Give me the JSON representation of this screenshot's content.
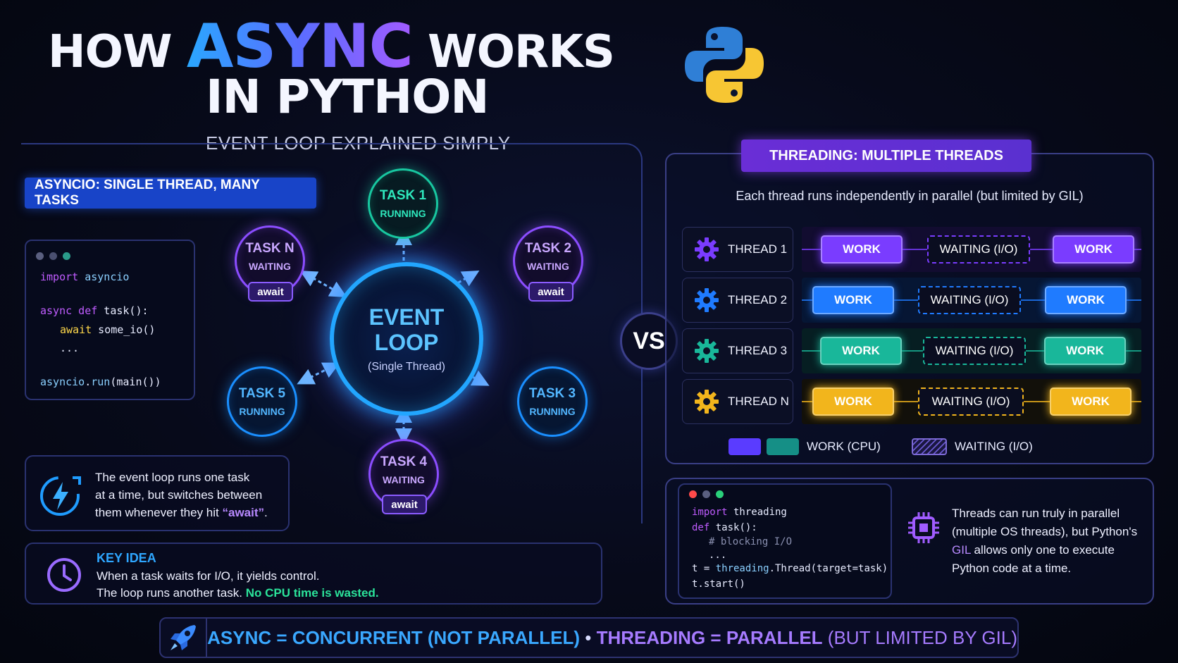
{
  "title": {
    "word1": "HOW",
    "word2": "ASYNC",
    "word3": "WORKS",
    "line2": "IN PYTHON",
    "subtitle": "EVENT LOOP EXPLAINED SIMPLY"
  },
  "asyncio": {
    "badge": "ASYNCIO: SINGLE THREAD, MANY TASKS",
    "code": {
      "l1_kw": "import",
      "l1_rest": " asyncio",
      "l2_kw": "async def",
      "l2_rest": " task():",
      "l3_kw": "await",
      "l3_rest": " some_io()",
      "l4": "...",
      "l5_a": "asyncio",
      "l5_b": ".",
      "l5_c": "run",
      "l5_d": "(main())"
    },
    "event_loop": {
      "line1": "EVENT",
      "line2": "LOOP",
      "sub": "(Single Thread)"
    },
    "tasks": [
      {
        "name": "TASK 1",
        "state": "RUNNING"
      },
      {
        "name": "TASK 2",
        "state": "WAITING",
        "pill": "await"
      },
      {
        "name": "TASK 3",
        "state": "RUNNING"
      },
      {
        "name": "TASK 4",
        "state": "WAITING",
        "pill": "await"
      },
      {
        "name": "TASK 5",
        "state": "RUNNING"
      },
      {
        "name": "TASK N",
        "state": "WAITING",
        "pill": "await"
      }
    ],
    "note": {
      "l1": "The event loop runs one task",
      "l2": "at a time, but switches between",
      "l3a": "them whenever they hit ",
      "l3b": "“await”",
      "l3c": "."
    },
    "key_idea": {
      "title": "KEY IDEA",
      "l1": "When a task waits for I/O, it yields control.",
      "l2a": "The loop runs another task. ",
      "l2b": "No CPU time is wasted."
    }
  },
  "vs": "VS",
  "threading": {
    "badge": "THREADING: MULTIPLE THREADS",
    "caption": "Each thread runs independently in parallel (but limited by GIL)",
    "threads": [
      {
        "name": "THREAD 1",
        "color": "#7a3cff",
        "work1": "WORK",
        "wait": "WAITING (I/O)",
        "work2": "WORK"
      },
      {
        "name": "THREAD 2",
        "color": "#1f7bff",
        "work1": "WORK",
        "wait": "WAITING (I/O)",
        "work2": "WORK"
      },
      {
        "name": "THREAD 3",
        "color": "#19b79a",
        "work1": "WORK",
        "wait": "WAITING (I/O)",
        "work2": "WORK"
      },
      {
        "name": "THREAD N",
        "color": "#f2b51c",
        "work1": "WORK",
        "wait": "WAITING (I/O)",
        "work2": "WORK"
      }
    ],
    "legend": {
      "work": "WORK (CPU)",
      "wait": "WAITING (I/O)"
    },
    "code": {
      "l1_kw": "import",
      "l1_rest": " threading",
      "l2_kw": "def",
      "l2_rest": " task():",
      "l3": "# blocking I/O",
      "l4": "...",
      "l5_a": "t = ",
      "l5_b": "threading",
      "l5_c": ".Thread(target=task)",
      "l6": "t.start()"
    },
    "note": {
      "l1": "Threads can run truly in parallel",
      "l2": "(multiple OS threads), but Python's",
      "l3a": "GIL",
      "l3b": " allows only one to execute",
      "l4": "Python code at a time."
    }
  },
  "footer": {
    "a1": "ASYNC",
    "a2": " = ",
    "a3": "CONCURRENT (NOT PARALLEL)",
    "sep": " • ",
    "b1": "THREADING",
    "b2": " = ",
    "b3": "PARALLEL",
    "b4": " (BUT LIMITED BY GIL)"
  },
  "icons": {
    "logo": "python-logo",
    "bolt": "lightning-icon",
    "clock": "clock-icon",
    "gear": "gear-icon",
    "chip": "cpu-chip-icon",
    "rocket": "rocket-icon"
  }
}
